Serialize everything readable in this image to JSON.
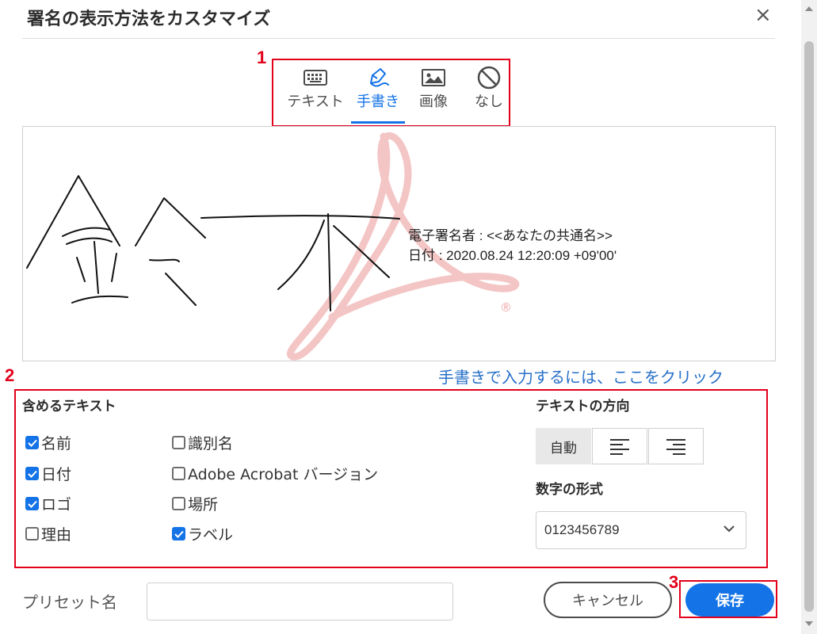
{
  "dialog": {
    "title": "署名の表示方法をカスタマイズ",
    "close_label": "×"
  },
  "callouts": [
    "1",
    "2",
    "3"
  ],
  "tabs": [
    {
      "label": "テキスト",
      "icon": "keyboard-icon",
      "active": false
    },
    {
      "label": "手書き",
      "icon": "pen-icon",
      "active": true
    },
    {
      "label": "画像",
      "icon": "image-icon",
      "active": false
    },
    {
      "label": "なし",
      "icon": "none-icon",
      "active": false
    }
  ],
  "preview": {
    "signer_line": "電子署名者 : <<あなたの共通名>>",
    "date_line": "日付 : 2020.08.24 12:20:09 +09'00'",
    "registered_mark": "®"
  },
  "handwrite_link": "手書きで入力するには、ここをクリック",
  "include_text": {
    "title": "含めるテキスト",
    "options": [
      {
        "label": "名前",
        "checked": true
      },
      {
        "label": "日付",
        "checked": true
      },
      {
        "label": "ロゴ",
        "checked": true
      },
      {
        "label": "理由",
        "checked": false
      },
      {
        "label": "識別名",
        "checked": false
      },
      {
        "label": "Adobe Acrobat バージョン",
        "checked": false
      },
      {
        "label": "場所",
        "checked": false
      },
      {
        "label": "ラベル",
        "checked": true
      }
    ]
  },
  "text_direction": {
    "title": "テキストの方向",
    "auto_label": "自動",
    "selected": "auto"
  },
  "number_format": {
    "title": "数字の形式",
    "value": "0123456789"
  },
  "preset": {
    "label": "プリセット名",
    "value": ""
  },
  "buttons": {
    "cancel": "キャンセル",
    "save": "保存"
  },
  "colors": {
    "accent": "#1473e6",
    "callout_red": "#e2001a",
    "watermark": "#f4c5c5"
  }
}
